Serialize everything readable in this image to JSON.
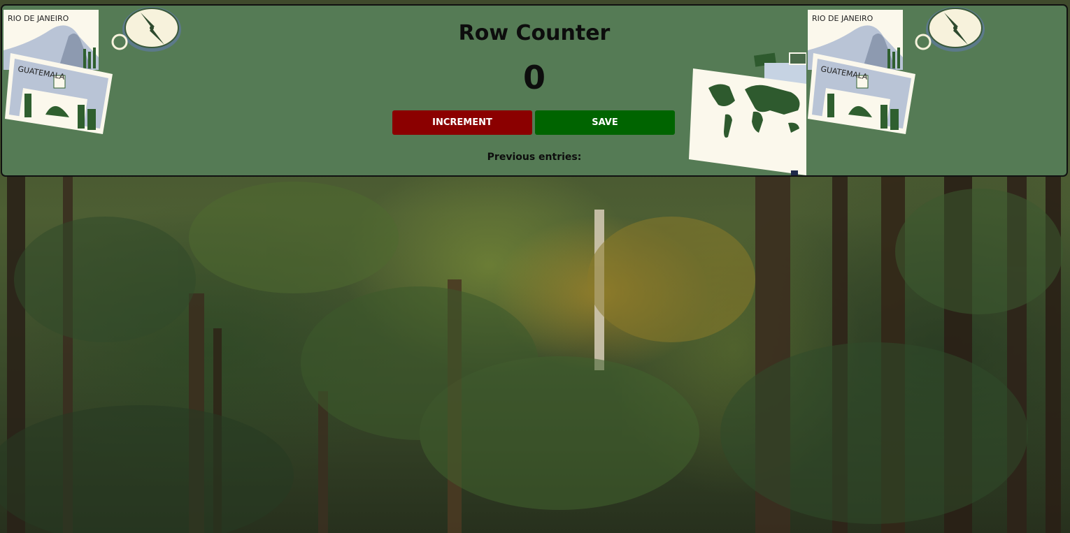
{
  "app": {
    "title": "Row Counter",
    "count": "0",
    "previous_entries_label": "Previous entries:"
  },
  "buttons": {
    "increment_label": "INCREMENT",
    "save_label": "SAVE"
  },
  "stickers": {
    "rio_label": "RIO DE JANEIRO",
    "guatemala_label": "GUATEMALA"
  },
  "colors": {
    "panel_bg": "#557b55",
    "increment_button": "#8b0000",
    "save_button": "#006400"
  },
  "icons": [
    "compass-icon",
    "world-map-icon",
    "rio-postcard-icon",
    "guatemala-postcard-icon"
  ]
}
